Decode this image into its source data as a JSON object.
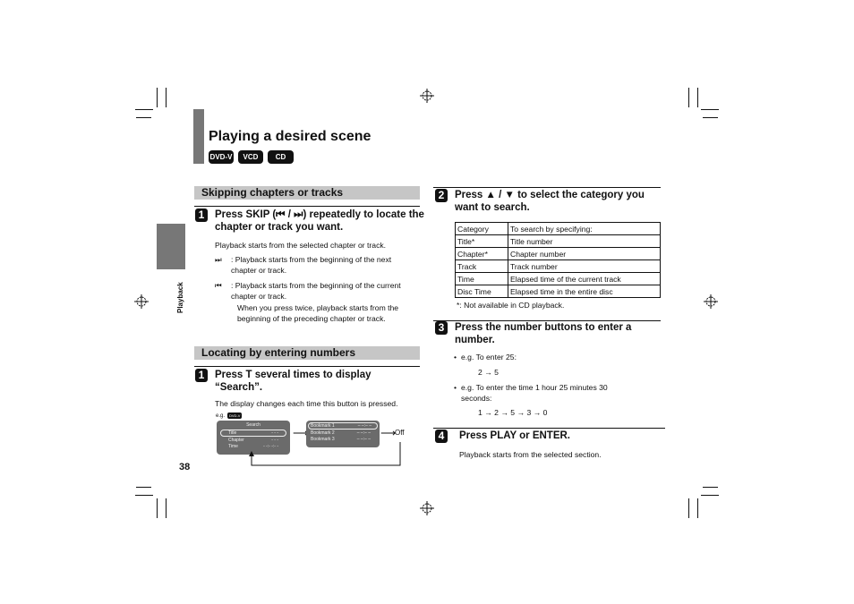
{
  "page": {
    "title": "Playing a desired scene",
    "badges": [
      "DVD-V",
      "VCD",
      "CD"
    ],
    "side_tab_label": "Playback",
    "page_number": "38"
  },
  "left": {
    "section1": {
      "heading": "Skipping chapters or tracks",
      "step1": {
        "number": "1",
        "text": "Press SKIP (⏮ / ⏭) repeatedly to locate the chapter or track you want.",
        "body": "Playback starts from the selected chapter or track.",
        "items": [
          {
            "icon": "⏭",
            "text": ": Playback starts from the beginning of the next chapter or track."
          },
          {
            "icon": "⏮",
            "text": ": Playback starts from the beginning of the current chapter or track."
          }
        ],
        "note": "When you press twice, playback starts from the beginning of the preceding chapter or track."
      }
    },
    "section2": {
      "heading": "Locating by entering numbers",
      "step1": {
        "number": "1",
        "text": "Press T several times to display “Search”.",
        "body": "The display changes each time this button is pressed."
      },
      "diagram": {
        "eg_label": "e.g.",
        "eg_badge": "DVD-V",
        "search_screen": {
          "title": "Search",
          "rows": [
            {
              "label": "Title",
              "value": "- - -"
            },
            {
              "label": "Chapter",
              "value": "- - -"
            },
            {
              "label": "Time",
              "value": "- -:- -:- -"
            }
          ]
        },
        "bookmark_screen": {
          "rows": [
            {
              "label": "Bookmark 1",
              "value": "– –:– –"
            },
            {
              "label": "Bookmark 2",
              "value": "– –:– –"
            },
            {
              "label": "Bookmark 3",
              "value": "– –:– –"
            }
          ]
        },
        "off_label": "Off"
      }
    }
  },
  "right": {
    "step2": {
      "number": "2",
      "text": "Press ▲ / ▼ to select the category you want to search.",
      "table": {
        "headers": [
          "Category",
          "To search by specifying:"
        ],
        "rows": [
          [
            "Title*",
            "Title number"
          ],
          [
            "Chapter*",
            "Chapter number"
          ],
          [
            "Track",
            "Track number"
          ],
          [
            "Time",
            "Elapsed time of the current track"
          ],
          [
            "Disc Time",
            "Elapsed time in the entire disc"
          ]
        ]
      },
      "footnote": "*: Not available in CD playback."
    },
    "step3": {
      "number": "3",
      "text": "Press the number buttons to enter a number.",
      "examples": [
        {
          "label": "e.g. To enter 25:",
          "sequence": "2 → 5"
        },
        {
          "label": "e.g. To enter the time 1 hour 25 minutes 30 seconds:",
          "sequence": "1 → 2 → 5 → 3 → 0"
        }
      ]
    },
    "step4": {
      "number": "4",
      "text": "Press PLAY or ENTER.",
      "body": "Playback starts from the selected section."
    }
  }
}
